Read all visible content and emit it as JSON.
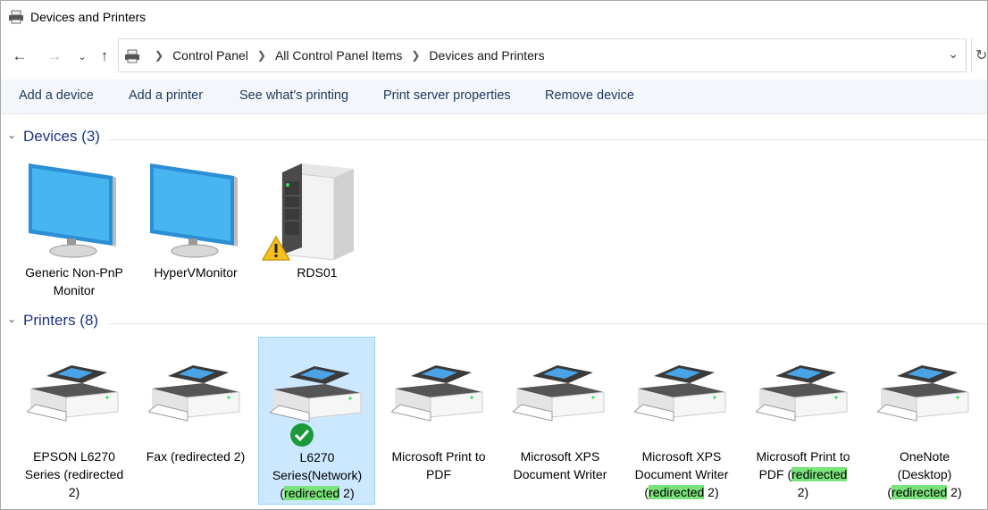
{
  "window": {
    "title": "Devices and Printers"
  },
  "address": {
    "crumbs": [
      "Control Panel",
      "All Control Panel Items",
      "Devices and Printers"
    ]
  },
  "commands": [
    "Add a device",
    "Add a printer",
    "See what's printing",
    "Print server properties",
    "Remove device"
  ],
  "devices": {
    "title": "Devices (3)",
    "items": [
      {
        "line1": "Generic Non-PnP",
        "line2": "Monitor",
        "icon": "monitor-icon"
      },
      {
        "line1": "HyperVMonitor",
        "line2": "",
        "icon": "monitor-icon"
      },
      {
        "line1": "RDS01",
        "line2": "",
        "icon": "server-icon",
        "warning": true
      }
    ]
  },
  "printers": {
    "title": "Printers (8)",
    "items": [
      {
        "l1": "EPSON L6270",
        "l2": "Series (redirected",
        "l3": "2)"
      },
      {
        "l1": "Fax (redirected 2)",
        "l2": "",
        "l3": ""
      },
      {
        "l1": "L6270",
        "l2": "Series(Network)",
        "l3a": "(",
        "l3hl": "redirected",
        "l3b": " 2)",
        "default": true,
        "selected": true
      },
      {
        "l1": "Microsoft Print to",
        "l2": "PDF",
        "l3": ""
      },
      {
        "l1": "Microsoft XPS",
        "l2": "Document Writer",
        "l3": ""
      },
      {
        "l1": "Microsoft XPS",
        "l2": "Document Writer",
        "l3a": "(",
        "l3hl": "redirected",
        "l3b": " 2)"
      },
      {
        "l1": "Microsoft Print to",
        "l2a": "PDF (",
        "l2hl": "redirected",
        "l3": "2)"
      },
      {
        "l1": "OneNote",
        "l2": "(Desktop)",
        "l3a": "(",
        "l3hl": "redirected",
        "l3b": " 2)"
      }
    ]
  },
  "colors": {
    "accent": "#1e3287",
    "selection": "#cce8ff",
    "highlight": "#7be37b",
    "commandbar": "#f3f6fb"
  }
}
